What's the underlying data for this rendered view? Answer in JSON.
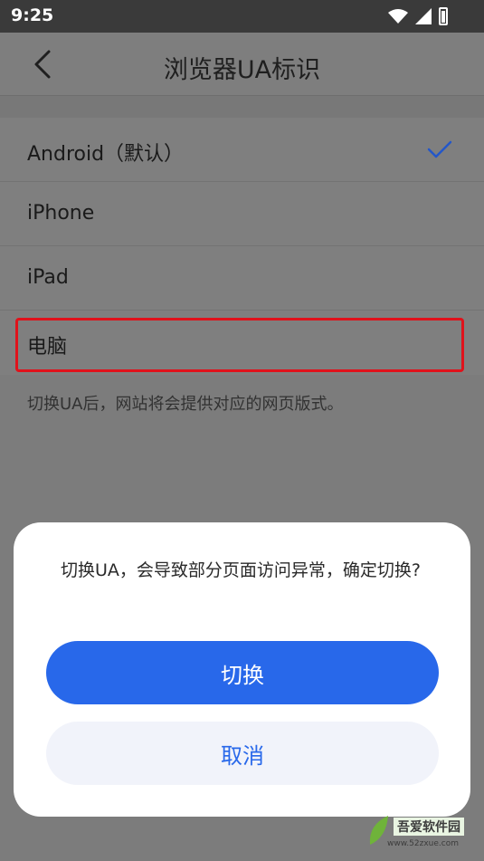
{
  "status_bar": {
    "time": "9:25",
    "icons": [
      "wifi-icon",
      "signal-icon",
      "battery-charging-icon"
    ]
  },
  "header": {
    "back_icon": "chevron-left-icon",
    "title": "浏览器UA标识"
  },
  "ua_options": [
    {
      "label": "Android（默认）",
      "selected": true
    },
    {
      "label": "iPhone",
      "selected": false
    },
    {
      "label": "iPad",
      "selected": false
    },
    {
      "label": "电脑",
      "selected": false
    }
  ],
  "hint": "切换UA后，网站将会提供对应的网页版式。",
  "dialog": {
    "message": "切换UA，会导致部分页面访问异常，确定切换?",
    "confirm_label": "切换",
    "cancel_label": "取消"
  },
  "watermark": {
    "name": "吾爱软件园",
    "url": "www.52zxue.com"
  },
  "colors": {
    "accent": "#2868ea",
    "highlight": "#e0121b",
    "cancel_bg": "#f1f3fa"
  }
}
